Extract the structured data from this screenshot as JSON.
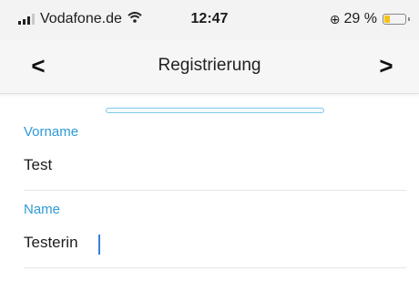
{
  "status_bar": {
    "carrier": "Vodafone.de",
    "time": "12:47",
    "battery_percent": "29 %",
    "battery_level": 0.29,
    "icons": [
      "signal-icon",
      "wifi-icon",
      "battery-icon"
    ]
  },
  "nav": {
    "title": "Registrierung",
    "back_glyph": "<",
    "forward_glyph": ">"
  },
  "form": {
    "first_name": {
      "label": "Vorname",
      "value": "Test"
    },
    "last_name": {
      "label": "Name",
      "value": "Testerin"
    }
  },
  "colors": {
    "accent": "#2e9ad6",
    "progress_border": "#7ec9e9",
    "battery": "#f4c21a"
  }
}
